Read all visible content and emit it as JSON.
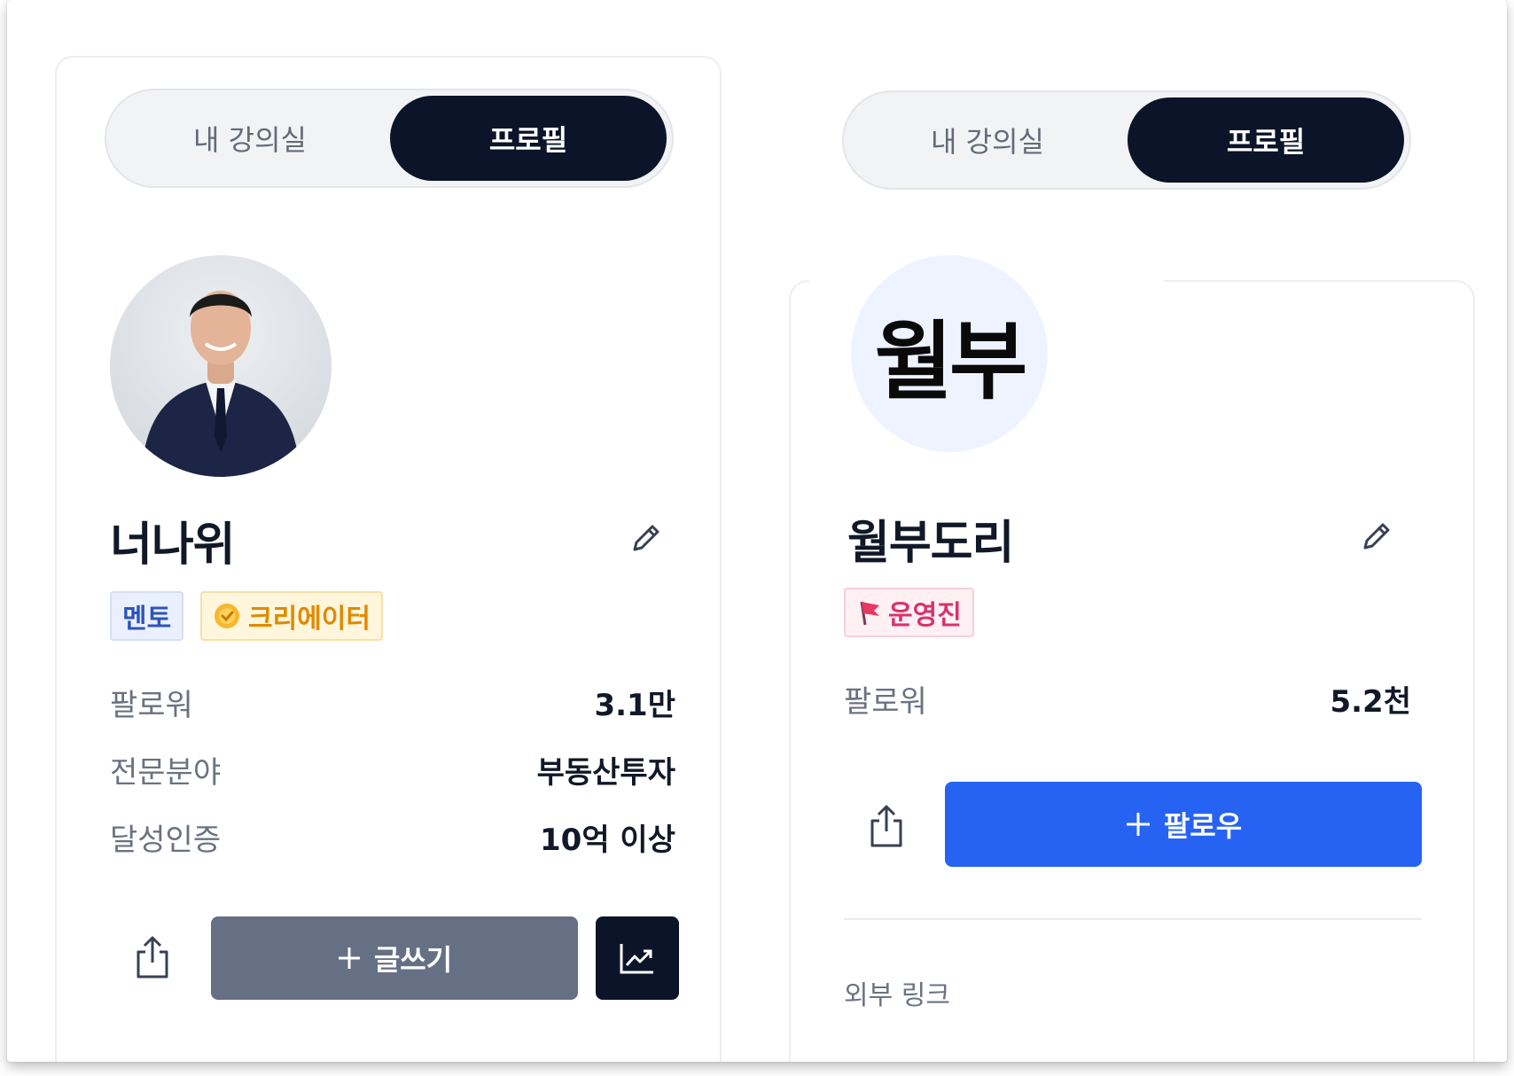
{
  "left_panel": {
    "tabs": {
      "inactive": "내 강의실",
      "active": "프로필"
    },
    "name": "너나위",
    "badges": {
      "mentor": "멘토",
      "creator": "크리에이터"
    },
    "stats": [
      {
        "label": "팔로워",
        "value": "3.1만"
      },
      {
        "label": "전문분야",
        "value": "부동산투자"
      },
      {
        "label": "달성인증",
        "value": "10억 이상"
      }
    ],
    "write_button": "글쓰기"
  },
  "right_panel": {
    "tabs": {
      "inactive": "내 강의실",
      "active": "프로필"
    },
    "avatar_text": "월부",
    "name": "월부도리",
    "badges": {
      "staff": "운영진"
    },
    "stats": [
      {
        "label": "팔로워",
        "value": "5.2천"
      }
    ],
    "follow_button": "팔로우",
    "external_link_label": "외부 링크"
  },
  "colors": {
    "dark": "#0b1428",
    "primary_blue": "#2663f2",
    "slate_button": "#667085"
  },
  "icons": [
    "pencil-icon",
    "share-icon",
    "plus-icon",
    "chart-trend-icon",
    "check-seal-icon",
    "flag-icon"
  ]
}
